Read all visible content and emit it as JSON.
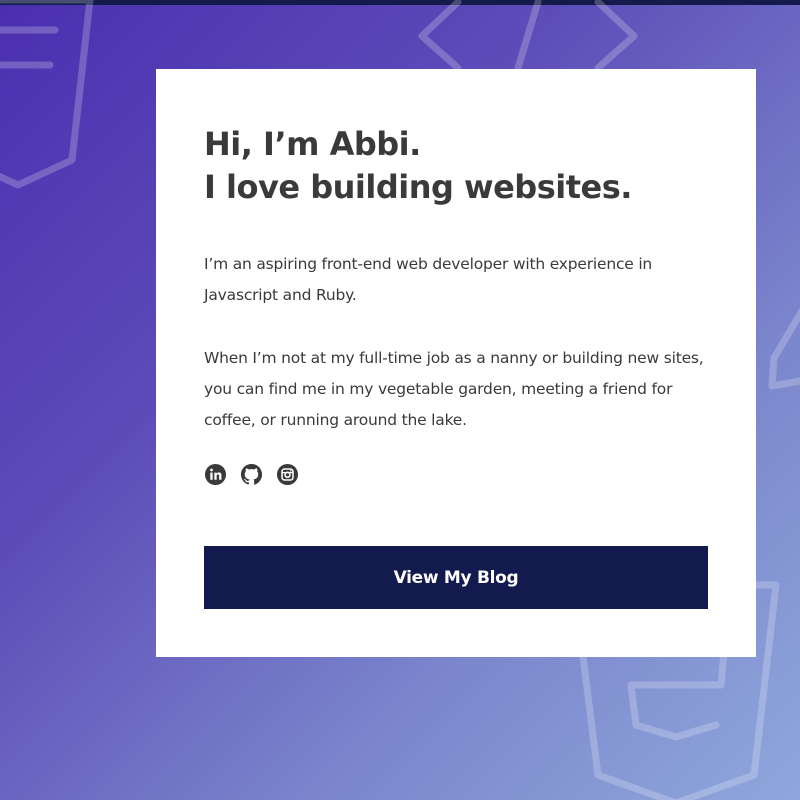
{
  "profile": {
    "greeting": "Hi, I’m Abbi.",
    "tagline": "I love building websites."
  },
  "about": {
    "paragraph_1": "I’m an aspiring front-end web developer with experience in Javascript and Ruby.",
    "paragraph_2": "When I’m not at my full-time job as a nanny or building new sites, you can find me in my vegetable garden, meeting a friend for coffee, or running around the lake."
  },
  "social": {
    "icons": [
      "linkedin-icon",
      "github-icon",
      "instagram-icon"
    ]
  },
  "cta": {
    "label": "View My Blog"
  },
  "colors": {
    "button_bg": "#131a4d",
    "text": "#3a3a3a",
    "card_bg": "#ffffff",
    "gradient_start": "#4a2fb0",
    "gradient_end": "#8fa7dc"
  }
}
